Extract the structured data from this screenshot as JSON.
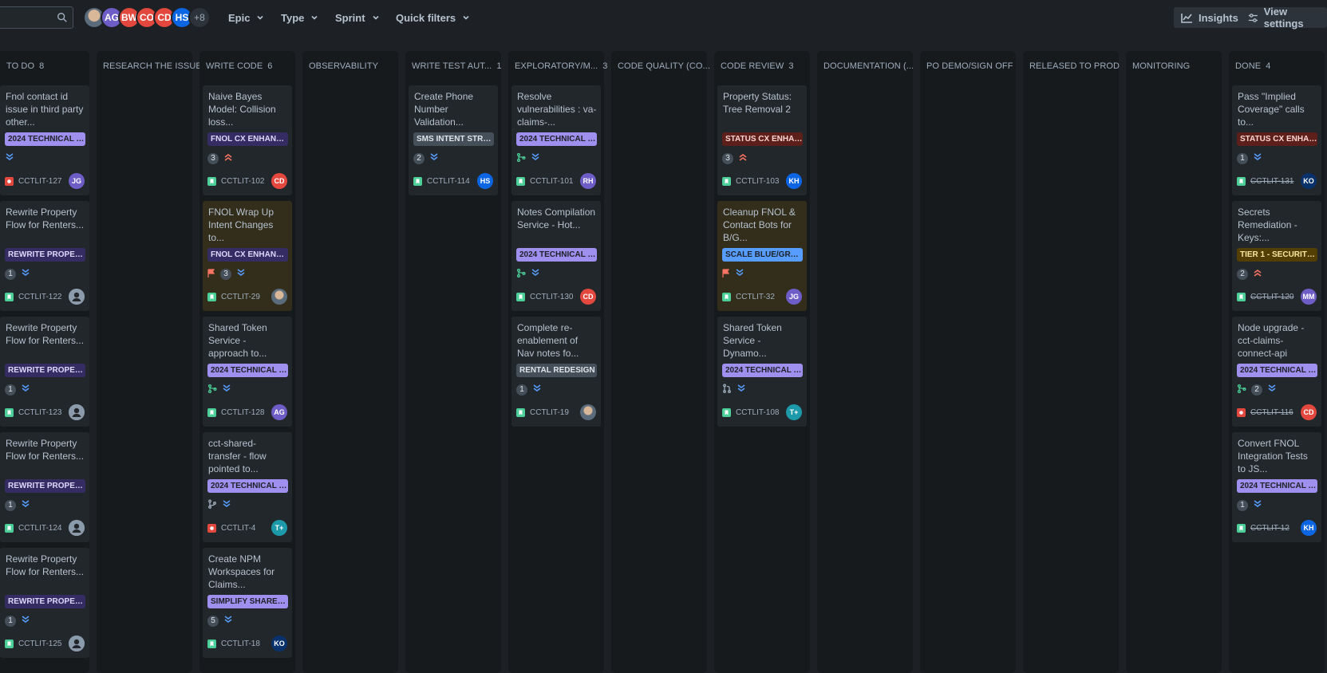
{
  "toolbar": {
    "avatars": [
      {
        "initials": "",
        "color": "#8c9bab",
        "photo": true
      },
      {
        "initials": "AG",
        "color": "#6e5dc6"
      },
      {
        "initials": "BW",
        "color": "#e2483d"
      },
      {
        "initials": "CO",
        "color": "#e2483d"
      },
      {
        "initials": "CD",
        "color": "#e2483d"
      },
      {
        "initials": "HS",
        "color": "#0c66e4"
      }
    ],
    "more_count": "+8",
    "filters": [
      "Epic",
      "Type",
      "Sprint",
      "Quick filters"
    ],
    "insights_label": "Insights",
    "view_settings_label": "View settings"
  },
  "columns": [
    {
      "name": "TO DO",
      "count": "8",
      "cards": [
        {
          "title": "Fnol contact id issue in third party other...",
          "epic": "2024 TECHNICAL DE...",
          "epic_style": "purple",
          "estimate": "",
          "priority": "lowest",
          "type": "bug",
          "key": "CCTLIT-127",
          "assignee": "JG",
          "assignee_color": "#6e5dc6"
        },
        {
          "title": "Rewrite Property Flow for Renters...",
          "epic": "REWRITE PROPERTY...",
          "epic_style": "dpurple",
          "estimate": "1",
          "priority": "lowest",
          "type": "story",
          "key": "CCTLIT-122",
          "assignee": "",
          "assignee_color": "unassigned"
        },
        {
          "title": "Rewrite Property Flow for Renters...",
          "epic": "REWRITE PROPERTY...",
          "epic_style": "dpurple",
          "estimate": "1",
          "priority": "lowest",
          "type": "story",
          "key": "CCTLIT-123",
          "assignee": "",
          "assignee_color": "unassigned"
        },
        {
          "title": "Rewrite Property Flow for Renters...",
          "epic": "REWRITE PROPERTY...",
          "epic_style": "dpurple",
          "estimate": "1",
          "priority": "lowest",
          "type": "story",
          "key": "CCTLIT-124",
          "assignee": "",
          "assignee_color": "unassigned"
        },
        {
          "title": "Rewrite Property Flow for Renters...",
          "epic": "REWRITE PROPERTY...",
          "epic_style": "dpurple",
          "estimate": "1",
          "priority": "lowest",
          "type": "story",
          "key": "CCTLIT-125",
          "assignee": "",
          "assignee_color": "unassigned"
        }
      ]
    },
    {
      "name": "RESEARCH THE ISSUE",
      "count": "",
      "cards": []
    },
    {
      "name": "WRITE CODE",
      "count": "6",
      "cards": [
        {
          "title": "Naive Bayes Model: Collision loss...",
          "epic": "FNOL CX ENHANCE...",
          "epic_style": "dpurple",
          "estimate": "3",
          "priority": "highest",
          "type": "story",
          "key": "CCTLIT-102",
          "assignee": "CD",
          "assignee_color": "#e2483d"
        },
        {
          "title": "FNOL Wrap Up Intent Changes to...",
          "epic": "FNOL CX ENHANCE...",
          "epic_style": "dpurple",
          "estimate": "3",
          "priority": "lowest",
          "flag": true,
          "type": "story",
          "key": "CCTLIT-29",
          "assignee": "",
          "assignee_color": "photo",
          "highlight": true
        },
        {
          "title": "Shared Token Service - approach to...",
          "epic": "2024 TECHNICAL DE...",
          "epic_style": "purple",
          "estimate": "",
          "pr": "merged",
          "priority": "lowest",
          "type": "story",
          "key": "CCTLIT-128",
          "assignee": "AG",
          "assignee_color": "#6e5dc6"
        },
        {
          "title": "cct-shared-transfer - flow pointed to...",
          "epic": "2024 TECHNICAL DE...",
          "epic_style": "purple",
          "estimate": "",
          "pr": "branch",
          "priority": "lowest",
          "type": "bug",
          "key": "CCTLIT-4",
          "assignee": "T+",
          "assignee_color": "#1d9aaa"
        },
        {
          "title": "Create NPM Workspaces for Claims...",
          "epic": "SIMPLIFY SHARED L...",
          "epic_style": "purple",
          "estimate": "5",
          "priority": "lowest",
          "type": "story",
          "key": "CCTLIT-18",
          "assignee": "KO",
          "assignee_color": "#09326c"
        }
      ]
    },
    {
      "name": "OBSERVABILITY",
      "count": "",
      "cards": []
    },
    {
      "name": "WRITE TEST AUT...",
      "count": "1",
      "cards": [
        {
          "title": "Create Phone Number Validation...",
          "epic": "SMS INTENT STRUC...",
          "epic_style": "gray",
          "estimate": "2",
          "priority": "lowest",
          "type": "story",
          "key": "CCTLIT-114",
          "assignee": "HS",
          "assignee_color": "#0c66e4"
        }
      ]
    },
    {
      "name": "EXPLORATORY/M...",
      "count": "3",
      "cards": [
        {
          "title": "Resolve vulnerabilities : va-claims-...",
          "epic": "2024 TECHNICAL DE...",
          "epic_style": "purple",
          "estimate": "",
          "pr": "merged",
          "priority": "lowest",
          "type": "story",
          "key": "CCTLIT-101",
          "assignee": "RH",
          "assignee_color": "#6e5dc6"
        },
        {
          "title": "Notes Compilation Service - Hot...",
          "epic": "2024 TECHNICAL DE...",
          "epic_style": "purple",
          "estimate": "",
          "pr": "merged",
          "priority": "lowest",
          "type": "story",
          "key": "CCTLIT-130",
          "assignee": "CD",
          "assignee_color": "#e2483d"
        },
        {
          "title": "Complete re-enablement of Nav notes fo...",
          "epic": "RENTAL REDESIGN",
          "epic_style": "gray",
          "estimate": "1",
          "priority": "lowest",
          "type": "story",
          "key": "CCTLIT-19",
          "assignee": "",
          "assignee_color": "photo"
        }
      ]
    },
    {
      "name": "CODE QUALITY (CO...",
      "count": "",
      "cards": []
    },
    {
      "name": "CODE REVIEW",
      "count": "3",
      "cards": [
        {
          "title": "Property Status: Tree Removal 2",
          "epic": "STATUS CX ENHANC...",
          "epic_style": "red",
          "estimate": "3",
          "priority": "highest",
          "type": "story",
          "key": "CCTLIT-103",
          "assignee": "KH",
          "assignee_color": "#0c66e4"
        },
        {
          "title": "Cleanup FNOL & Contact Bots for B/G...",
          "epic": "SCALE BLUE/GREEN",
          "epic_style": "blue",
          "estimate": "",
          "priority": "lowest",
          "flag": true,
          "type": "story",
          "key": "CCTLIT-32",
          "assignee": "JG",
          "assignee_color": "#6e5dc6",
          "highlight": true
        },
        {
          "title": "Shared Token Service - Dynamo...",
          "epic": "2024 TECHNICAL DE...",
          "epic_style": "purple",
          "estimate": "",
          "pr": "open",
          "priority": "lowest",
          "type": "story",
          "key": "CCTLIT-108",
          "assignee": "T+",
          "assignee_color": "#1d9aaa"
        }
      ]
    },
    {
      "name": "DOCUMENTATION (...",
      "count": "",
      "cards": []
    },
    {
      "name": "PO DEMO/SIGN OFF",
      "count": "",
      "cards": []
    },
    {
      "name": "RELEASED TO PROD",
      "count": "",
      "cards": []
    },
    {
      "name": "MONITORING",
      "count": "",
      "cards": []
    },
    {
      "name": "DONE",
      "count": "4",
      "cards": [
        {
          "title": "Pass \"Implied Coverage\" calls to...",
          "epic": "STATUS CX ENHANC...",
          "epic_style": "red",
          "estimate": "1",
          "priority": "lowest",
          "type": "story",
          "key": "CCTLIT-131",
          "assignee": "KO",
          "assignee_color": "#09326c",
          "done": true
        },
        {
          "title": "Secrets Remediation - Keys:...",
          "epic": "TIER 1 - SECURITY/C...",
          "epic_style": "yellow",
          "estimate": "2",
          "priority": "highest",
          "type": "story",
          "key": "CCTLIT-120",
          "assignee": "MM",
          "assignee_color": "#6e5dc6",
          "done": true
        },
        {
          "title": "Node upgrade - cct-claims-connect-api",
          "epic": "2024 TECHNICAL DE...",
          "epic_style": "purple",
          "estimate": "2",
          "pr": "merged",
          "priority": "lowest",
          "type": "bug",
          "key": "CCTLIT-116",
          "assignee": "CD",
          "assignee_color": "#e2483d",
          "done": true
        },
        {
          "title": "Convert FNOL Integration Tests to JS...",
          "epic": "2024 TECHNICAL DE...",
          "epic_style": "purple",
          "estimate": "1",
          "priority": "lowest",
          "type": "story",
          "key": "CCTLIT-12",
          "assignee": "KH",
          "assignee_color": "#0c66e4",
          "done": true
        }
      ]
    }
  ]
}
